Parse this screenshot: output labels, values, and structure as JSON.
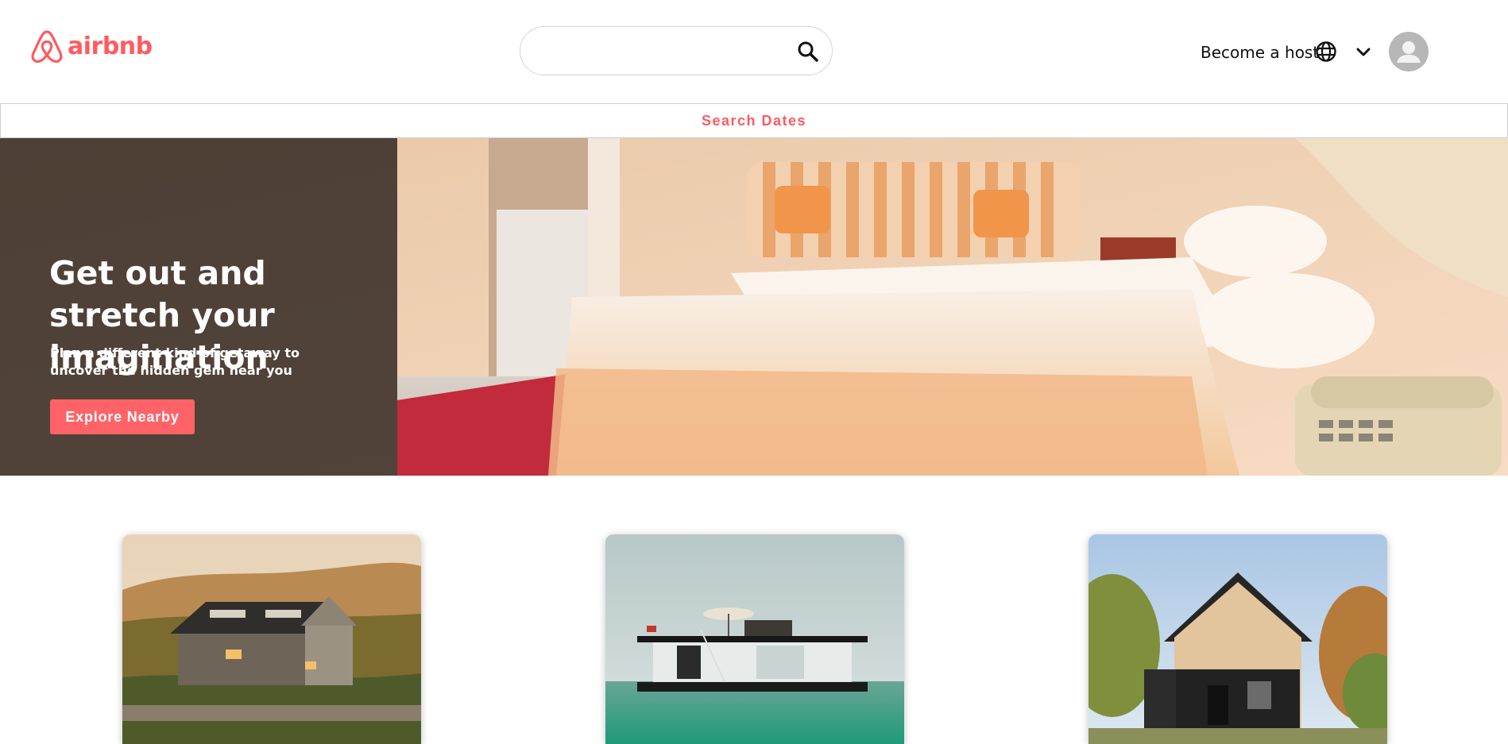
{
  "brand": {
    "name": "airbnb",
    "color": "#ff5a5f",
    "icon": "airbnb-logo-icon"
  },
  "header": {
    "search": {
      "value": "",
      "placeholder": "",
      "icon": "search-icon"
    },
    "host_link": "Become a host",
    "language_icon": "globe-icon",
    "menu_icon": "chevron-down-icon",
    "profile_icon": "user-avatar-icon"
  },
  "dates_bar": {
    "label": "Search Dates"
  },
  "hero": {
    "title": "Get out and stretch your imagination",
    "subtitle": "Plan a different kind of getaway to uncover the hidden gem near you",
    "cta": "Explore Nearby",
    "image": "hotel-room-photo"
  },
  "cards": [
    {
      "image": "wooden-cottage-hills-photo"
    },
    {
      "image": "houseboat-on-water-photo"
    },
    {
      "image": "modern-a-frame-house-photo"
    }
  ],
  "colors": {
    "accent": "#ff5a5f",
    "button": "#ff6368"
  }
}
